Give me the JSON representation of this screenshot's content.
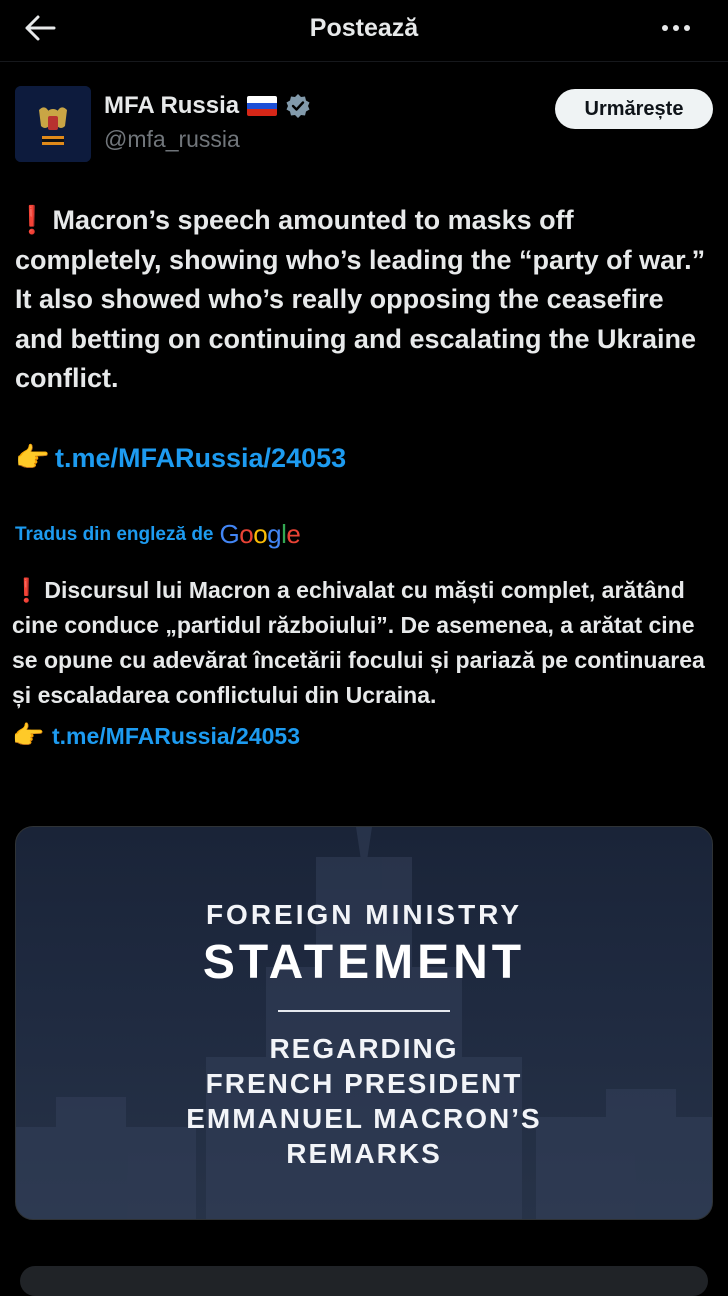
{
  "header": {
    "title": "Postează",
    "back_icon": "arrow-left-icon",
    "more_icon": "more-horizontal-icon"
  },
  "author": {
    "name": "MFA Russia",
    "flag": "🇷🇺",
    "verified_icon": "verified-badge-icon",
    "handle": "@mfa_russia",
    "follow_label": "Urmărește"
  },
  "post": {
    "line_emoji": "❗",
    "text": "Macron’s speech amounted to masks off completely, showing who’s leading the “party of war.” It also showed who’s really opposing the ceasefire and betting on continuing and escalating the Ukraine conflict.",
    "link_emoji": "👉",
    "link": "t.me/MFARussia/24053"
  },
  "translation": {
    "label": "Tradus din engleză de",
    "provider": "Google",
    "line_emoji": "❗",
    "text": "Discursul lui Macron a echivalat cu măști complet, arătând cine conduce „partidul războiului”. De asemenea, a arătat cine se opune cu adevărat încetării focului și pariază pe continuarea și escaladarea conflictului din Ucraina.",
    "link_emoji": "👉",
    "link": "t.me/MFARussia/24053"
  },
  "media": {
    "line1": "FOREIGN MINISTRY",
    "line2": "STATEMENT",
    "sub1": "REGARDING",
    "sub2": "FRENCH PRESIDENT",
    "sub3": "EMMANUEL MACRON’S",
    "sub4": "REMARKS"
  },
  "colors": {
    "background": "#000000",
    "text": "#e7e9ea",
    "secondary": "#71767b",
    "link": "#1d9bf0",
    "verified": "#829aab"
  }
}
